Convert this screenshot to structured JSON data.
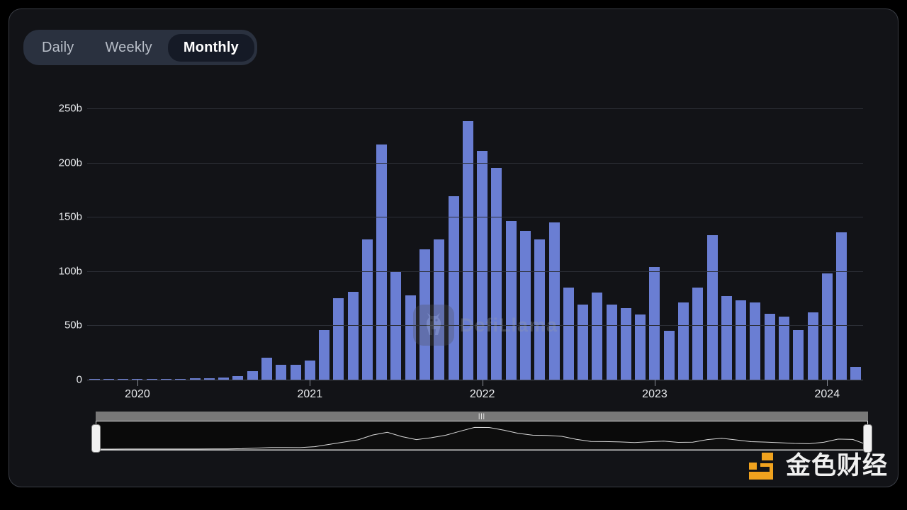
{
  "panel": {
    "background": "#121317",
    "border": "#3a3d45"
  },
  "tabs": {
    "items": [
      {
        "label": "Daily",
        "active": false
      },
      {
        "label": "Weekly",
        "active": false
      },
      {
        "label": "Monthly",
        "active": true
      }
    ]
  },
  "watermark": {
    "text": "DefiLlama",
    "icon": "llama-logo-icon"
  },
  "brand": {
    "text": "金色财经",
    "accent": "#f0a21e",
    "icon": "jinse-logo-icon"
  },
  "slider": {
    "grip": "|||",
    "left_handle": "range-start-handle",
    "right_handle": "range-end-handle"
  },
  "chart_data": {
    "type": "bar",
    "title": "",
    "subtitle": "",
    "xlabel": "",
    "ylabel": "",
    "grid": true,
    "legend": "none",
    "bar_color": "#6a7ed3",
    "ylim": [
      0,
      250
    ],
    "ytick_labels": [
      "0",
      "50b",
      "100b",
      "150b",
      "200b",
      "250b"
    ],
    "ytick_values": [
      0,
      50,
      100,
      150,
      200,
      250
    ],
    "xtick_labels": [
      "2020",
      "2021",
      "2022",
      "2023",
      "2024"
    ],
    "xtick_indices": [
      3,
      15,
      27,
      39,
      51
    ],
    "categories": [
      "2019-10",
      "2019-11",
      "2019-12",
      "2020-01",
      "2020-02",
      "2020-03",
      "2020-04",
      "2020-05",
      "2020-06",
      "2020-07",
      "2020-08",
      "2020-09",
      "2020-10",
      "2020-11",
      "2020-12",
      "2021-01",
      "2021-02",
      "2021-03",
      "2021-04",
      "2021-05",
      "2021-06",
      "2021-07",
      "2021-08",
      "2021-09",
      "2021-10",
      "2021-11",
      "2021-12",
      "2022-01",
      "2022-02",
      "2022-03",
      "2022-04",
      "2022-05",
      "2022-06",
      "2022-07",
      "2022-08",
      "2022-09",
      "2022-10",
      "2022-11",
      "2022-12",
      "2023-01",
      "2023-02",
      "2023-03",
      "2023-04",
      "2023-05",
      "2023-06",
      "2023-07",
      "2023-08",
      "2023-09",
      "2023-10",
      "2023-11",
      "2023-12",
      "2024-01"
    ],
    "values": [
      0.2,
      0.3,
      0.4,
      0.5,
      0.6,
      0.8,
      0.9,
      1.0,
      1.2,
      2.0,
      3.0,
      8.0,
      20.0,
      13.5,
      14.0,
      17.5,
      46.0,
      75.0,
      81.0,
      129.0,
      217.0,
      99.5,
      78.0,
      120.0,
      129.0,
      169.0,
      238.0,
      211.0,
      195.0,
      146.0,
      137.0,
      129.0,
      145.0,
      85.0,
      69.0,
      80.0,
      69.0,
      66.0,
      60.0,
      104.0,
      45.0,
      71.0,
      85.0,
      133.0,
      77.0,
      73.0,
      71.0,
      61.0,
      58.0,
      46.0,
      62.0,
      98.0,
      136.0,
      12.0
    ]
  }
}
